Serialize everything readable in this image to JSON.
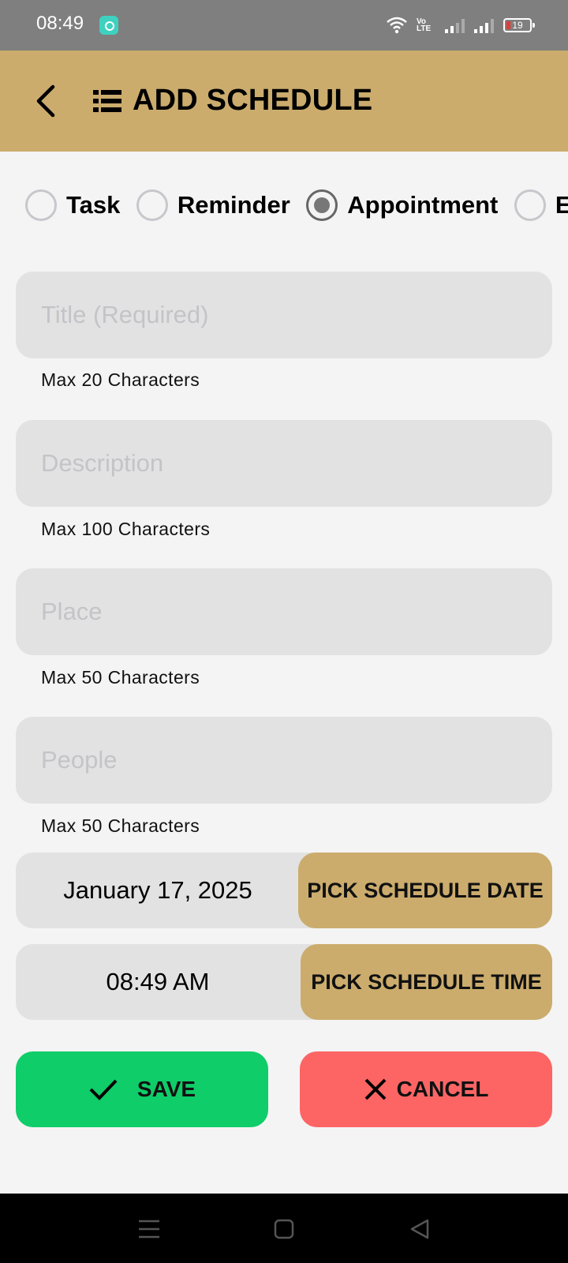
{
  "status_bar": {
    "time": "08:49",
    "volte_label": "Vo LTE",
    "battery_level": "19"
  },
  "header": {
    "title": "ADD SCHEDULE",
    "back_icon": "chevron-left-icon",
    "title_icon": "list-icon",
    "background_color": "#cbac6d"
  },
  "schedule_types": [
    {
      "label": "Task",
      "selected": false
    },
    {
      "label": "Reminder",
      "selected": false
    },
    {
      "label": "Appointment",
      "selected": true
    },
    {
      "label": "Event",
      "selected": false
    }
  ],
  "fields": {
    "title": {
      "placeholder": "Title (Required)",
      "value": "",
      "hint": "Max 20 Characters"
    },
    "description": {
      "placeholder": "Description",
      "value": "",
      "hint": "Max 100 Characters"
    },
    "place": {
      "placeholder": "Place",
      "value": "",
      "hint": "Max 50 Characters"
    },
    "people": {
      "placeholder": "People",
      "value": "",
      "hint": "Max 50 Characters"
    }
  },
  "date_picker": {
    "value": "January 17, 2025",
    "button_label": "PICK SCHEDULE DATE"
  },
  "time_picker": {
    "value": "08:49 AM",
    "button_label": "PICK SCHEDULE TIME"
  },
  "actions": {
    "save_label": "SAVE",
    "save_color": "#0fcd69",
    "cancel_label": "CANCEL",
    "cancel_color": "#fd6565"
  },
  "nav_bar": {
    "icons": [
      "menu-icon",
      "home-square-icon",
      "back-triangle-icon"
    ]
  }
}
